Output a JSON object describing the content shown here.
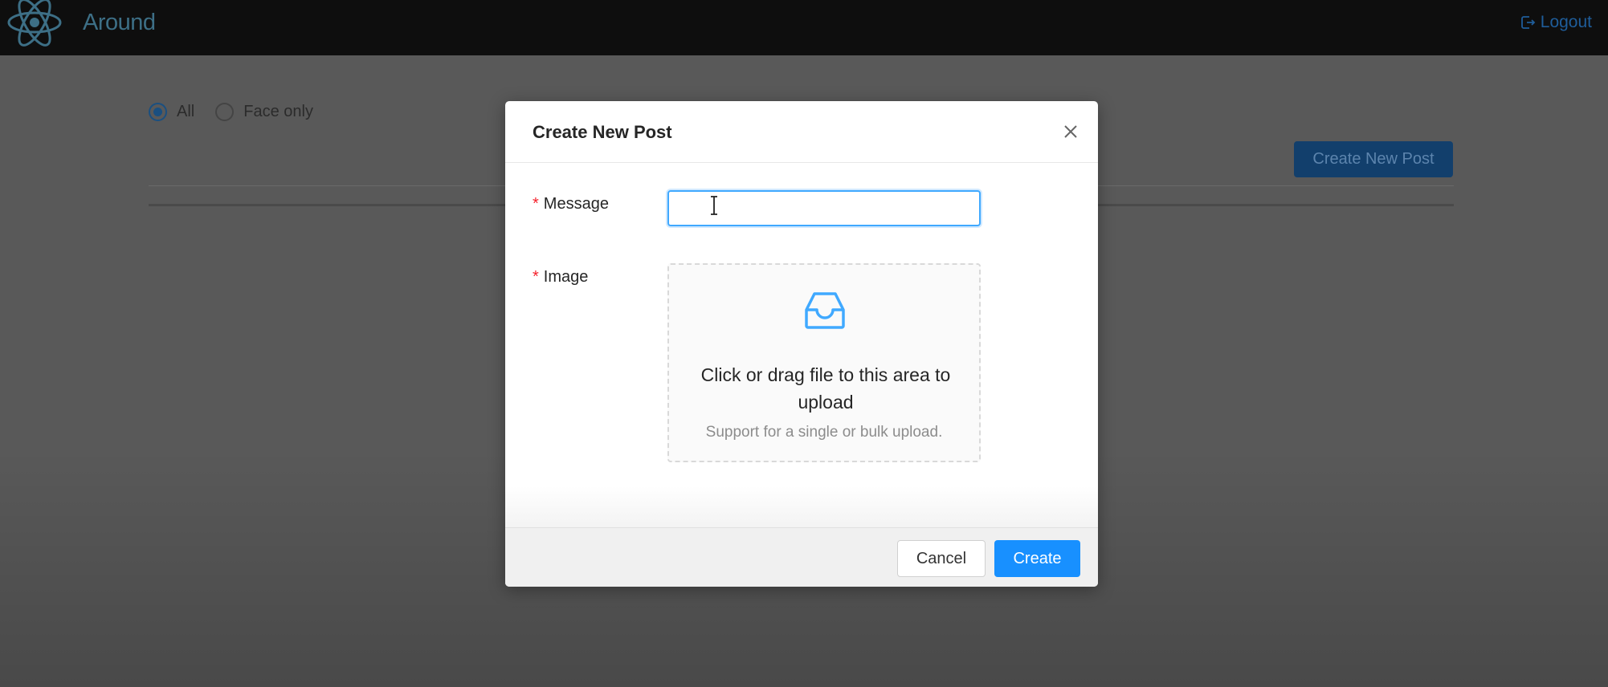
{
  "header": {
    "app_title": "Around",
    "logout_label": "Logout",
    "logo_icon": "react-atom-icon",
    "logout_icon": "logout-icon"
  },
  "page": {
    "filter_options": [
      {
        "label": "All",
        "checked": true
      },
      {
        "label": "Face only",
        "checked": false
      }
    ],
    "create_button_label": "Create New Post"
  },
  "modal": {
    "title": "Create New Post",
    "close_icon": "close-icon",
    "fields": {
      "message": {
        "label": "Message",
        "required_mark": "*",
        "value": ""
      },
      "image": {
        "label": "Image",
        "required_mark": "*",
        "upload_text": "Click or drag file to this area to upload",
        "upload_hint": "Support for a single or bulk upload.",
        "icon": "inbox-icon"
      }
    },
    "cancel_label": "Cancel",
    "create_label": "Create"
  },
  "colors": {
    "header_bg": "#0e0e0e",
    "primary": "#1890ff",
    "required": "#f5222d"
  }
}
